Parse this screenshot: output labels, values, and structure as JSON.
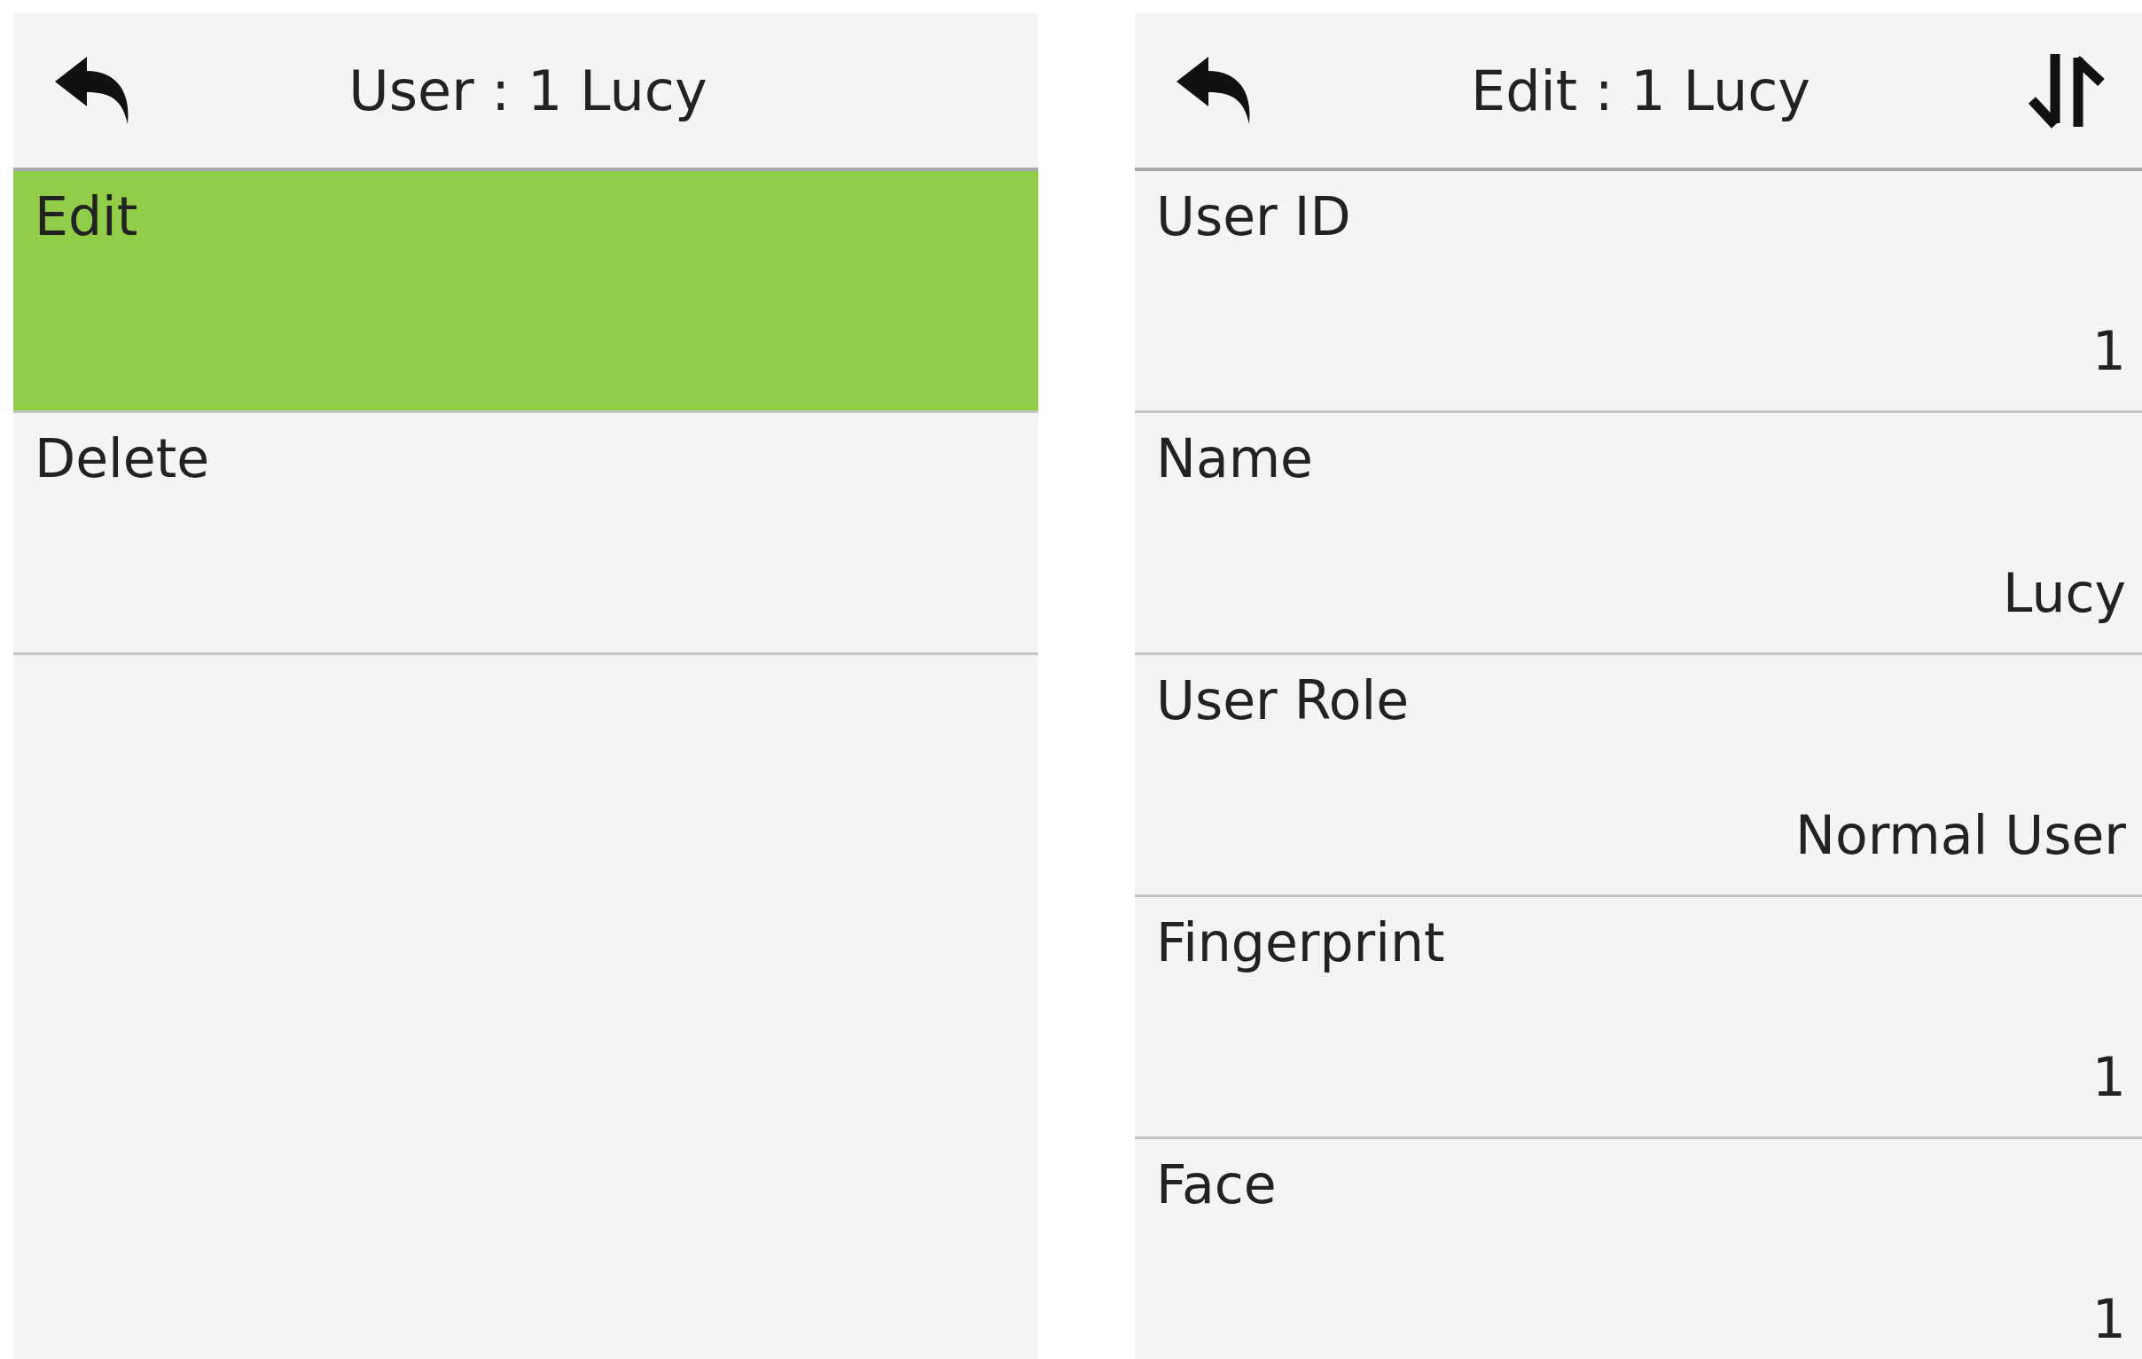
{
  "menu_screen": {
    "title": "User : 1 Lucy",
    "items": [
      {
        "label": "Edit",
        "selected": true
      },
      {
        "label": "Delete",
        "selected": false
      }
    ]
  },
  "edit_screen": {
    "title": "Edit : 1 Lucy",
    "fields": [
      {
        "label": "User ID",
        "value": "1"
      },
      {
        "label": "Name",
        "value": "Lucy"
      },
      {
        "label": "User Role",
        "value": "Normal User"
      },
      {
        "label": "Fingerprint",
        "value": "1"
      },
      {
        "label": "Face",
        "value": "1"
      }
    ]
  }
}
